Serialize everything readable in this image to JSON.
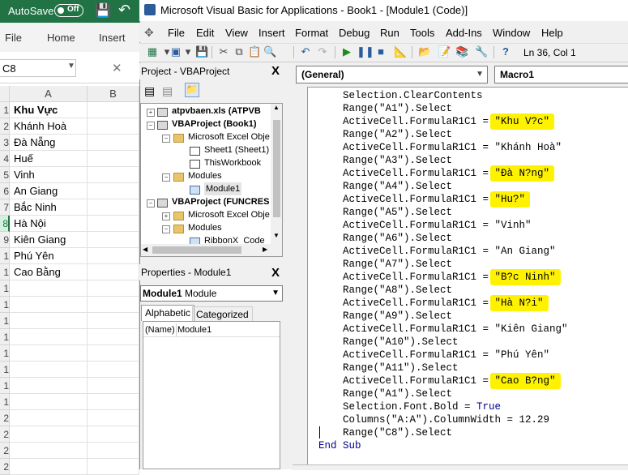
{
  "excel": {
    "autosave_label": "AutoSave",
    "autosave_state": "Off",
    "tabs": [
      "File",
      "Home",
      "Insert"
    ],
    "namebox": "C8",
    "column_headers": [
      "A",
      "B"
    ],
    "rows": [
      {
        "num": "1",
        "value": "Khu Vực"
      },
      {
        "num": "2",
        "value": "Khánh Hoà"
      },
      {
        "num": "3",
        "value": "Đà Nẵng"
      },
      {
        "num": "4",
        "value": "Huế"
      },
      {
        "num": "5",
        "value": "Vinh"
      },
      {
        "num": "6",
        "value": "An Giang"
      },
      {
        "num": "7",
        "value": "Bắc Ninh"
      },
      {
        "num": "8",
        "value": "Hà Nội"
      },
      {
        "num": "9",
        "value": "Kiên Giang"
      },
      {
        "num": "1",
        "value": "Phú Yên"
      },
      {
        "num": "1",
        "value": "Cao Bằng"
      },
      {
        "num": "1",
        "value": ""
      },
      {
        "num": "1",
        "value": ""
      },
      {
        "num": "1",
        "value": ""
      },
      {
        "num": "1",
        "value": ""
      },
      {
        "num": "1",
        "value": ""
      },
      {
        "num": "1",
        "value": ""
      },
      {
        "num": "1",
        "value": ""
      },
      {
        "num": "1",
        "value": ""
      },
      {
        "num": "2",
        "value": ""
      },
      {
        "num": "2",
        "value": ""
      },
      {
        "num": "2",
        "value": ""
      },
      {
        "num": "2",
        "value": ""
      }
    ]
  },
  "vba": {
    "title": "Microsoft Visual Basic for Applications - Book1 - [Module1 (Code)]",
    "menu": [
      "File",
      "Edit",
      "View",
      "Insert",
      "Format",
      "Debug",
      "Run",
      "Tools",
      "Add-Ins",
      "Window",
      "Help"
    ],
    "cursor_position": "Ln 36, Col 1",
    "project_pane": {
      "title": "Project - VBAProject",
      "close": "X",
      "tree": [
        "atpvbaen.xls (ATPVB",
        "VBAProject (Book1)",
        "Microsoft Excel Obje",
        "Sheet1 (Sheet1)",
        "ThisWorkbook",
        "Modules",
        "Module1",
        "VBAProject (FUNCRES",
        "Microsoft Excel Obje",
        "Modules",
        "RibbonX_Code"
      ]
    },
    "properties_pane": {
      "title": "Properties - Module1",
      "close": "X",
      "object_name": "Module1",
      "object_type": "Module",
      "tabs": [
        "Alphabetic",
        "Categorized"
      ],
      "row_name": "(Name)",
      "row_value": "Module1"
    },
    "code": {
      "object_combo": "(General)",
      "proc_combo": "Macro1",
      "lines": [
        "    Selection.ClearContents",
        "    Range(\"A1\").Select",
        "    ActiveCell.FormulaR1C1 = \"Khu V?c\"",
        "    Range(\"A2\").Select",
        "    ActiveCell.FormulaR1C1 = \"Khánh Hoà\"",
        "    Range(\"A3\").Select",
        "    ActiveCell.FormulaR1C1 = \"Đà N?ng\"",
        "    Range(\"A4\").Select",
        "    ActiveCell.FormulaR1C1 = \"Hu?\"",
        "    Range(\"A5\").Select",
        "    ActiveCell.FormulaR1C1 = \"Vinh\"",
        "    Range(\"A6\").Select",
        "    ActiveCell.FormulaR1C1 = \"An Giang\"",
        "    Range(\"A7\").Select",
        "    ActiveCell.FormulaR1C1 = \"B?c Ninh\"",
        "    Range(\"A8\").Select",
        "    ActiveCell.FormulaR1C1 = \"Hà N?i\"",
        "    Range(\"A9\").Select",
        "    ActiveCell.FormulaR1C1 = \"Kiên Giang\"",
        "    Range(\"A10\").Select",
        "    ActiveCell.FormulaR1C1 = \"Phú Yên\"",
        "    Range(\"A11\").Select",
        "    ActiveCell.FormulaR1C1 = \"Cao B?ng\"",
        "    Range(\"A1\").Select",
        "    Selection.Font.Bold = True",
        "    Columns(\"A:A\").ColumnWidth = 12.29",
        "    Range(\"C8\").Select",
        "End Sub"
      ],
      "highlighted_lines": [
        2,
        6,
        8,
        14,
        16,
        22
      ],
      "highlight_color": "#fff200"
    }
  }
}
